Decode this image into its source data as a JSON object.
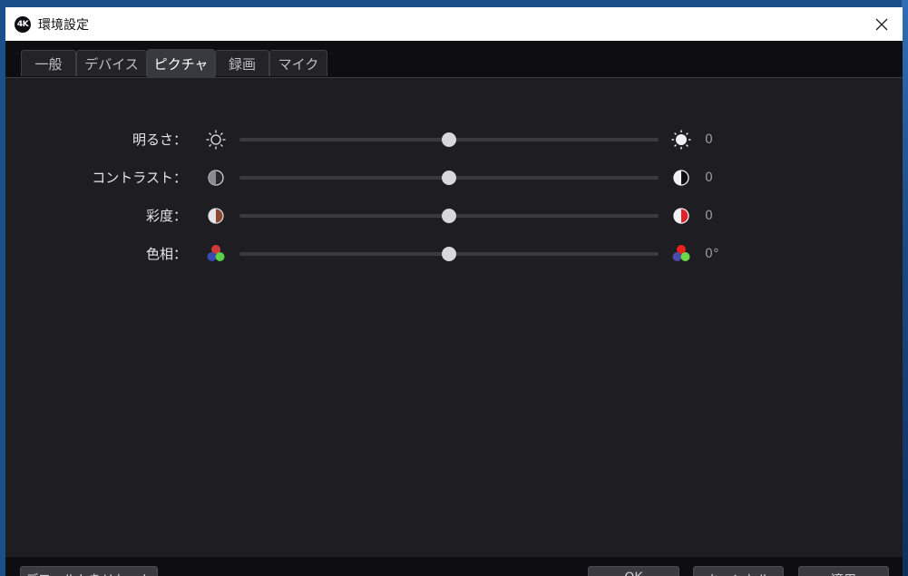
{
  "window": {
    "title": "環境設定",
    "app_icon_text": "4K"
  },
  "tabs": [
    {
      "label": "一般",
      "active": false
    },
    {
      "label": "デバイス",
      "active": false
    },
    {
      "label": "ピクチャ",
      "active": true
    },
    {
      "label": "録画",
      "active": false
    },
    {
      "label": "マイク",
      "active": false
    }
  ],
  "adjustments": [
    {
      "label": "明るさ：",
      "value_text": "0",
      "level_percent": 50,
      "icon_left": "sun-outline-icon",
      "icon_right": "sun-filled-icon"
    },
    {
      "label": "コントラスト：",
      "value_text": "0",
      "level_percent": 50,
      "icon_left": "contrast-low-icon",
      "icon_right": "contrast-high-icon"
    },
    {
      "label": "彩度：",
      "value_text": "0",
      "level_percent": 50,
      "icon_left": "saturation-low-icon",
      "icon_right": "saturation-high-icon"
    },
    {
      "label": "色相：",
      "value_text": "0°",
      "level_percent": 50,
      "icon_left": "hue-dots-icon",
      "icon_right": "hue-dots-shifted-icon"
    }
  ],
  "footer": {
    "reset_label": "デフォルトをリセット",
    "ok_label": "OK",
    "cancel_label": "キャンセル",
    "apply_label": "適用"
  },
  "colors": {
    "background": "#1e1e22",
    "track": "#3a3a40",
    "thumb": "#d8d8dc",
    "saturation_low": "#8a4a30",
    "saturation_high": "#e0202a",
    "hue_red": "#e03030",
    "hue_blue": "#3a4ab0",
    "hue_green": "#5cd04a"
  }
}
